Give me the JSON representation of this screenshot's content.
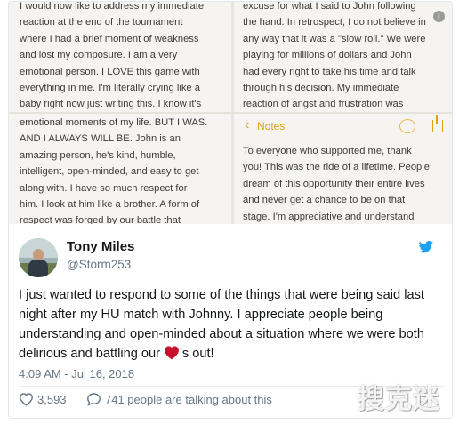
{
  "notes_images": {
    "top_left": "I would now like to address my immediate\nreaction at the end of the tournament\nwhere I had a brief moment of weakness\nand lost my composure. I am a very\nemotional person. I LOVE this game with\neverything in me. I'm literally crying like a\nbaby right now just writing this. I know it's\nhard for people to understand the",
    "top_right": "excuse for what I said to John following\nthe hand. In retrospect, I do not believe in\nany way that it was a \"slow roll.\" We were\nplaying for millions of dollars and John\nhad every right to take his time and talk\nthrough his decision. My immediate\nreaction of angst and frustration was\nunwarranted and I take full responsibility",
    "bottom_left": "emotional moments of my life. BUT I WAS.\nAND I ALWAYS WILL BE. John is an\namazing person, he's kind, humble,\nintelligent, open-minded, and easy to get\nalong with. I have so much respect for\nhim. I look at him like a brother. A form of\nrespect was forged by our battle that\nbonded us. I have a feeling we will be",
    "bottom_right": "To everyone who supported me, thank\nyou! This was the ride of a lifetime. People\ndream of this opportunity their entire lives\nand never get a chance to be on that\nstage. I'm appreciative and understand\nthat I ran way above EV to get in this",
    "notes_title": "Notes",
    "notes_back": "‹",
    "info": "i"
  },
  "tweet": {
    "display_name": "Tony Miles",
    "handle": "@Storm253",
    "text_before_emoji": "I just wanted to respond to some of the things that were being said last night after my HU match with Johnny. I appreciate people being understanding and open-minded about a situation where we were both delirious and battling our ",
    "text_after_emoji": "'s out!",
    "timestamp": "4:09 AM - Jul 16, 2018",
    "likes": "3,593",
    "talking": "741 people are talking about this",
    "heart_color": "#c8102e",
    "brand_color": "#1da1f2"
  },
  "watermark": {
    "text": "搜克迷"
  }
}
